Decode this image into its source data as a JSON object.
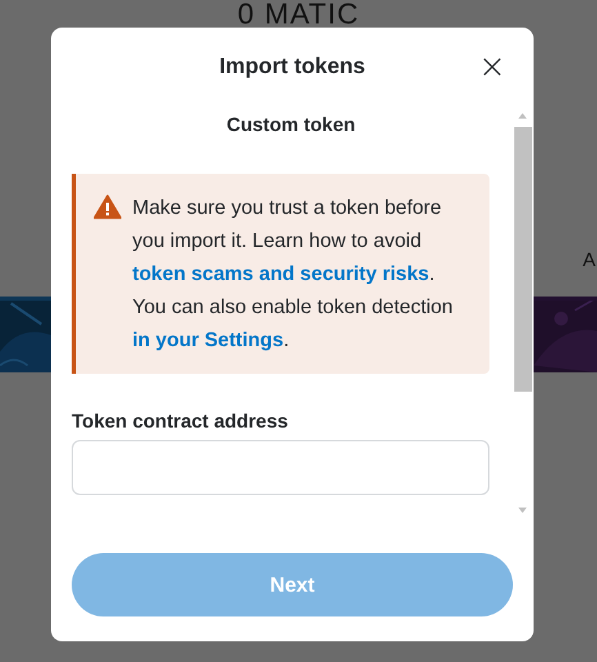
{
  "background": {
    "balance": "0 MATIC",
    "side_text": "A"
  },
  "modal": {
    "title": "Import tokens",
    "close": "×",
    "section_title": "Custom token",
    "warning": {
      "text_before": "Make sure you trust a token before you import it. Learn how to avoid ",
      "link_1": "token scams and security risks",
      "text_middle": ". You can also enable token detection ",
      "link_2": "in your Settings",
      "text_after": "."
    },
    "field": {
      "label": "Token contract address"
    },
    "next_button": {
      "label": "Next",
      "disabled": true
    }
  }
}
